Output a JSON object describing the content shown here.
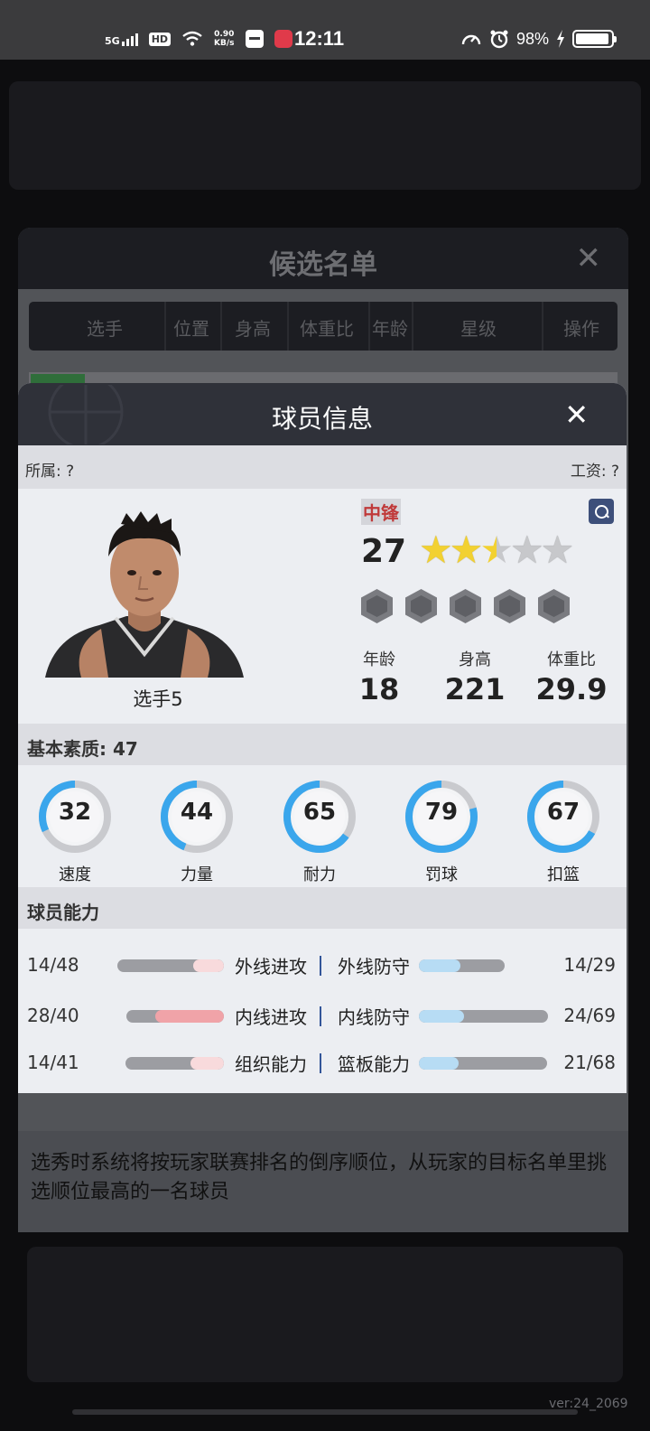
{
  "status_bar": {
    "network": "5G",
    "hd": "HD",
    "speed_value": "0.90",
    "speed_unit": "KB/s",
    "time": "12:11",
    "battery": "98%"
  },
  "candidate_dialog": {
    "title": "候选名单",
    "close": "✕",
    "columns": [
      "选手",
      "位置",
      "身高",
      "体重比",
      "年龄",
      "星级",
      "操作"
    ],
    "notice": "选秀时系统将按玩家联赛排名的倒序顺位，从玩家的目标名单里挑选顺位最高的一名球员"
  },
  "player_modal": {
    "title": "球员信息",
    "close": "✕",
    "affiliation": "所属: ?",
    "salary": "工资: ?",
    "player_name": "选手5",
    "position": "中锋",
    "overall": "27",
    "stars": {
      "value": 2.5,
      "max": 5
    },
    "attributes": [
      {
        "label": "年龄",
        "value": "18"
      },
      {
        "label": "身高",
        "value": "221"
      },
      {
        "label": "体重比",
        "value": "29.9"
      }
    ],
    "basic_quality_label": "基本素质: 47",
    "basic_stats": [
      {
        "label": "速度",
        "value": 32
      },
      {
        "label": "力量",
        "value": 44
      },
      {
        "label": "耐力",
        "value": 65
      },
      {
        "label": "罚球",
        "value": 79
      },
      {
        "label": "扣篮",
        "value": 67
      }
    ],
    "ability_label": "球员能力",
    "abilities": [
      {
        "left_value": "14/48",
        "left_label": "外线进攻",
        "right_label": "外线防守",
        "right_value": "14/29",
        "left_current": 14,
        "left_max": 48,
        "right_current": 14,
        "right_max": 29
      },
      {
        "left_value": "28/40",
        "left_label": "内线进攻",
        "right_label": "内线防守",
        "right_value": "24/69",
        "left_current": 28,
        "left_max": 40,
        "right_current": 24,
        "right_max": 69
      },
      {
        "left_value": "14/41",
        "left_label": "组织能力",
        "right_label": "篮板能力",
        "right_value": "21/68",
        "left_current": 14,
        "left_max": 41,
        "right_current": 21,
        "right_max": 68
      }
    ]
  },
  "version": "ver:24_2069",
  "colors": {
    "ring_blue": "#3aa6ec",
    "ring_track": "#c9cace",
    "attack_bar": "#f0a3a8",
    "attack_bar_light": "#f8dadc",
    "defense_bar": "#b7dcf4",
    "position_red": "#c03a3a"
  }
}
